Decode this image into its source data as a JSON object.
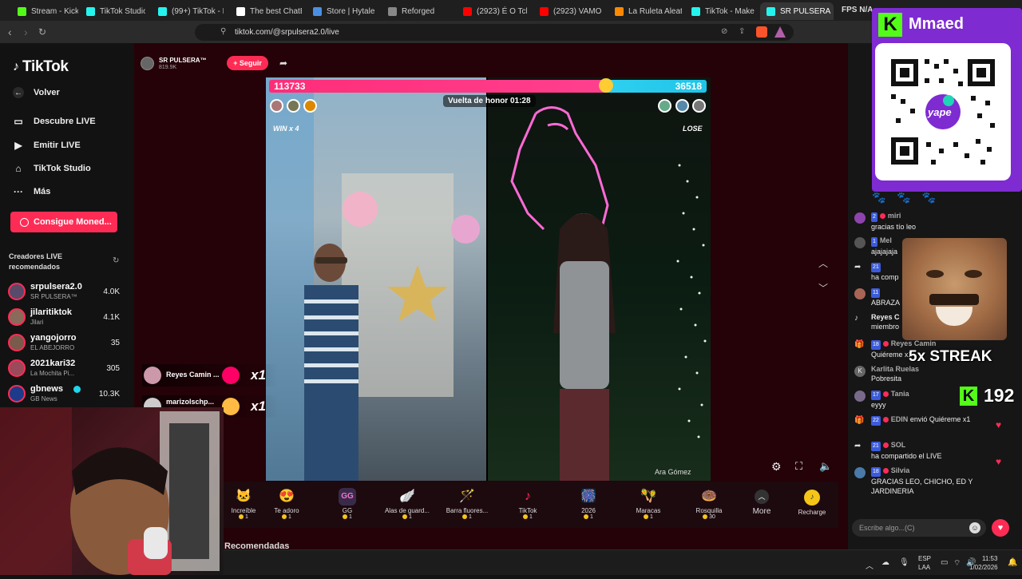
{
  "browser": {
    "tabs": [
      {
        "label": "Stream - Kick",
        "color": "#53fc18"
      },
      {
        "label": "TikTok Studio",
        "color": "#25f4ee"
      },
      {
        "label": "(99+) TikTok - Ma",
        "color": "#25f4ee"
      },
      {
        "label": "The best ChatBot",
        "color": "#ffffff"
      },
      {
        "label": "Store | Hytale",
        "color": "#4a90e2"
      },
      {
        "label": "Reforged",
        "color": "#888888"
      },
      {
        "label": "(2923) É O Tchan",
        "color": "#ff0000"
      },
      {
        "label": "(2923) VAMONO",
        "color": "#ff0000"
      },
      {
        "label": "La Ruleta Aleator",
        "color": "#ff8800"
      },
      {
        "label": "TikTok - Make Yo",
        "color": "#25f4ee"
      },
      {
        "label": "SR PULSERA",
        "color": "#25f4ee"
      }
    ],
    "url": "tiktok.com/@srpulsera2.0/live",
    "overlay_text": "FPS N/A"
  },
  "sidebar": {
    "brand": "TikTok",
    "back_label": "Volver",
    "items": [
      "Descubre LIVE",
      "Emitir LIVE",
      "TikTok Studio",
      "Más"
    ],
    "coins_button": "Consigue Moned...",
    "section_title": "Creadores LIVE recomendados",
    "creators": [
      {
        "name": "srpulsera2.0",
        "sub": "SR PULSERA™",
        "viewers": "4.0K"
      },
      {
        "name": "jilaritiktok",
        "sub": "Jilari",
        "viewers": "4.1K"
      },
      {
        "name": "yangojorro",
        "sub": "EL ABEJORRO",
        "viewers": "35"
      },
      {
        "name": "2021kari32",
        "sub": "La Mochita Pi...",
        "viewers": "305"
      },
      {
        "name": "gbnews",
        "sub": "GB News",
        "viewers": "10.3K"
      }
    ]
  },
  "live": {
    "host_name": "SR PULSERA™",
    "host_likes": "819.9K",
    "follow_label": "+ Seguir",
    "score_left": "113733",
    "score_right": "36518",
    "timer": "Vuelta de honor 01:28",
    "win_label": "WIN x 4",
    "lose_label": "LOSE",
    "right_host": "Ara Gómez",
    "gift_feed": [
      {
        "user": "Reyes Camin ...",
        "count": "x1"
      },
      {
        "user": "marizolschp...",
        "count": "x1"
      }
    ]
  },
  "gifts": [
    {
      "label": "Increíble",
      "price": "1",
      "icon": "🐱"
    },
    {
      "label": "Te adoro",
      "price": "1",
      "icon": "😍"
    },
    {
      "label": "GG",
      "price": "1",
      "icon": "GG"
    },
    {
      "label": "Alas de guard...",
      "price": "1",
      "icon": "🪽"
    },
    {
      "label": "Barra fluores...",
      "price": "1",
      "icon": "🪄"
    },
    {
      "label": "TikTok",
      "price": "1",
      "icon": "♪"
    },
    {
      "label": "2026",
      "price": "1",
      "icon": "🎆"
    },
    {
      "label": "Maracas",
      "price": "1",
      "icon": "🪇"
    },
    {
      "label": "Rosquilla",
      "price": "30",
      "icon": "🍩"
    }
  ],
  "gift_more": "More",
  "recharge": "Recharge",
  "recommended_heading": "Recomendadas",
  "chat": {
    "messages": [
      {
        "level": "2",
        "user": "miri",
        "text": "gracias tío leo"
      },
      {
        "level": "1",
        "user": "Mel",
        "text": "ajajajaja"
      },
      {
        "level": "21",
        "user": "",
        "text": "ha comp"
      },
      {
        "level": "11",
        "user": "",
        "text": "ABRAZA"
      },
      {
        "level": "",
        "user": "Reyes C",
        "text": "miembro"
      },
      {
        "level": "18",
        "user": "Reyes Camin",
        "text": "Quiéreme x1"
      },
      {
        "level": "",
        "user": "Karlita Ruelas",
        "text": "Pobresita"
      },
      {
        "level": "17",
        "user": "Tania",
        "text": "eyyy"
      },
      {
        "level": "22",
        "user": "EDIN",
        "text": "envió Quiéreme x1"
      },
      {
        "level": "21",
        "user": "SOL",
        "text": "ha compartido el LIVE"
      },
      {
        "level": "18",
        "user": "Silvia",
        "text": "GRACIAS LEO, CHICHO, ED Y JARDINERIA"
      }
    ],
    "input_placeholder": "Escribe algo...(C)"
  },
  "overlay": {
    "kick_name": "Mmaed",
    "qr_label": "yape",
    "streak_text": "5x STREAK",
    "streak_count": "192"
  },
  "taskbar": {
    "lang": "ESP",
    "layout": "LAA",
    "time": "11:53",
    "date": "1/02/2026"
  }
}
